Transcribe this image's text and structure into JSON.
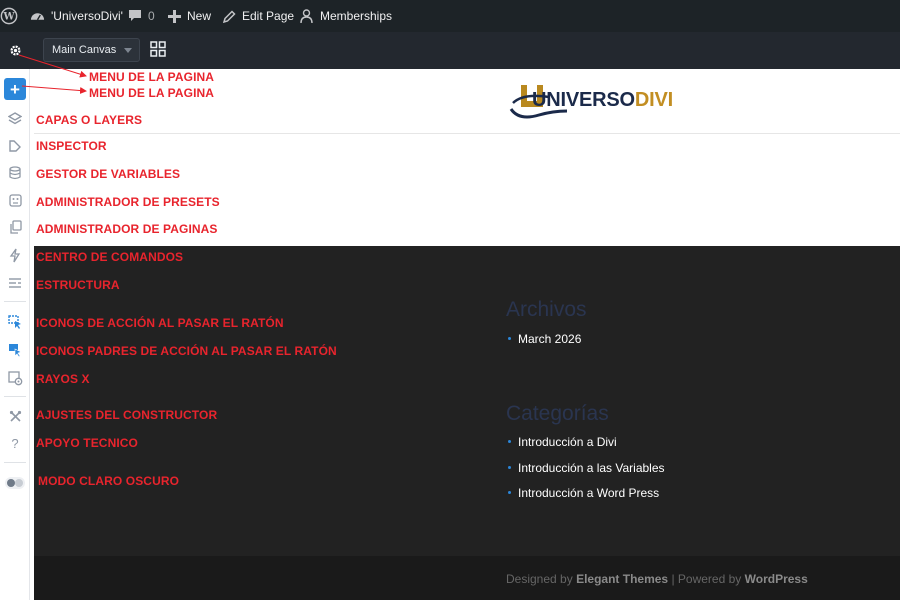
{
  "adminbar": {
    "site_name": "'UniversoDivi'",
    "comments_count": "0",
    "new_label": "New",
    "edit_label": "Edit Page",
    "memberships_label": "Memberships",
    "icons": [
      "wordpress-icon",
      "dashboard-icon",
      "comment-icon",
      "plus-icon",
      "pencil-icon",
      "memberships-icon"
    ]
  },
  "divibar": {
    "canvas_select": "Main Canvas",
    "icons": [
      "gear-icon",
      "grid-icon"
    ]
  },
  "sidebar": {
    "add_label": "+",
    "help_label": "?",
    "icons": [
      "layers-icon",
      "inspector-icon",
      "variables-icon",
      "presets-icon",
      "pages-icon",
      "bolt-icon",
      "structure-icon",
      "hover-icon",
      "hover-parent-icon",
      "xray-icon",
      "tools-icon",
      "help-icon",
      "mode-toggle-icon"
    ]
  },
  "annotations": {
    "menu1": "MENU DE LA PAGINA",
    "menu2": "MENU DE LA PAGINA",
    "layers": "CAPAS O LAYERS",
    "inspector": "INSPECTOR",
    "variables": "GESTOR DE VARIABLES",
    "presets": "ADMINISTRADOR DE PRESETS",
    "pages": "ADMINISTRADOR DE PAGINAS",
    "commands": "CENTRO DE COMANDOS",
    "structure": "ESTRUCTURA",
    "hover": "ICONOS DE ACCIÓN AL PASAR EL RATÓN",
    "hover_parent": "ICONOS PADRES DE ACCIÓN AL PASAR EL RATÓN",
    "xray": "RAYOS X",
    "settings": "AJUSTES DEL CONSTRUCTOR",
    "support": "APOYO TECNICO",
    "mode": "MODO CLARO OSCURO"
  },
  "site": {
    "logo_part1": "UNIVERSO",
    "logo_part2": "DIVI",
    "archives_title": "Archivos",
    "archives": [
      "March 2026"
    ],
    "categories_title": "Categorías",
    "categories": [
      "Introducción a Divi",
      "Introducción a las Variables",
      "Introducción a Word Press"
    ],
    "footer": {
      "designed_by": "Designed by",
      "elegant": "Elegant Themes",
      "separator": "|",
      "powered_by": "Powered by",
      "wordpress": "WordPress"
    }
  },
  "colors": {
    "annotation": "#e8242d",
    "accent": "#2b87da",
    "adminbar": "#1d2327",
    "content_bg": "#222222"
  }
}
